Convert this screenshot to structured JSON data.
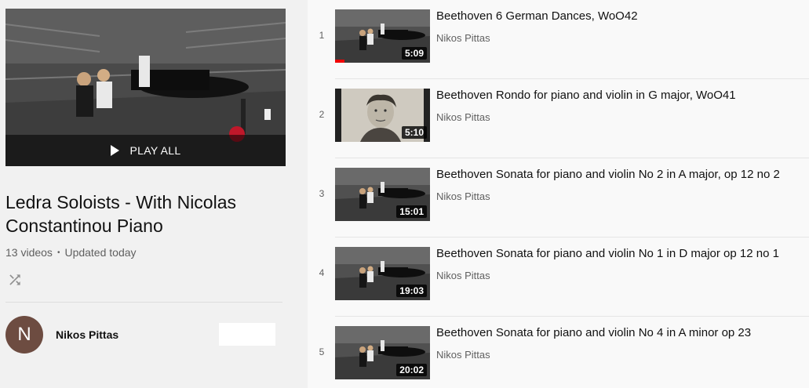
{
  "playlist": {
    "play_all_label": "PLAY ALL",
    "title": "Ledra Soloists - With Nicolas Constantinou Piano",
    "video_count": "13 videos",
    "updated": "Updated today",
    "owner_name": "Nikos Pittas",
    "owner_initial": "N",
    "avatar_color": "#6d4c41"
  },
  "videos": [
    {
      "index": "1",
      "title": "Beethoven 6 German Dances, WoO42",
      "channel": "Nikos Pittas",
      "duration": "5:09",
      "thumb": "concert",
      "watched": true
    },
    {
      "index": "2",
      "title": "Beethoven Rondo for piano and violin in G major, WoO41",
      "channel": "Nikos Pittas",
      "duration": "5:10",
      "thumb": "portrait",
      "watched": false
    },
    {
      "index": "3",
      "title": "Beethoven Sonata for piano and violin No 2 in A major, op 12 no 2",
      "channel": "Nikos Pittas",
      "duration": "15:01",
      "thumb": "concert",
      "watched": false
    },
    {
      "index": "4",
      "title": "Beethoven Sonata for piano and violin No 1 in D major op 12 no 1",
      "channel": "Nikos Pittas",
      "duration": "19:03",
      "thumb": "concert",
      "watched": false
    },
    {
      "index": "5",
      "title": "Beethoven Sonata for piano and violin No 4 in A minor op 23",
      "channel": "Nikos Pittas",
      "duration": "20:02",
      "thumb": "concert",
      "watched": false
    }
  ],
  "colors": {
    "progress": "#ee0000",
    "background": "#f9f9f9",
    "sidebar": "#f1f1f1"
  },
  "icons": {
    "shuffle": "shuffle-icon",
    "play": "play-icon"
  }
}
